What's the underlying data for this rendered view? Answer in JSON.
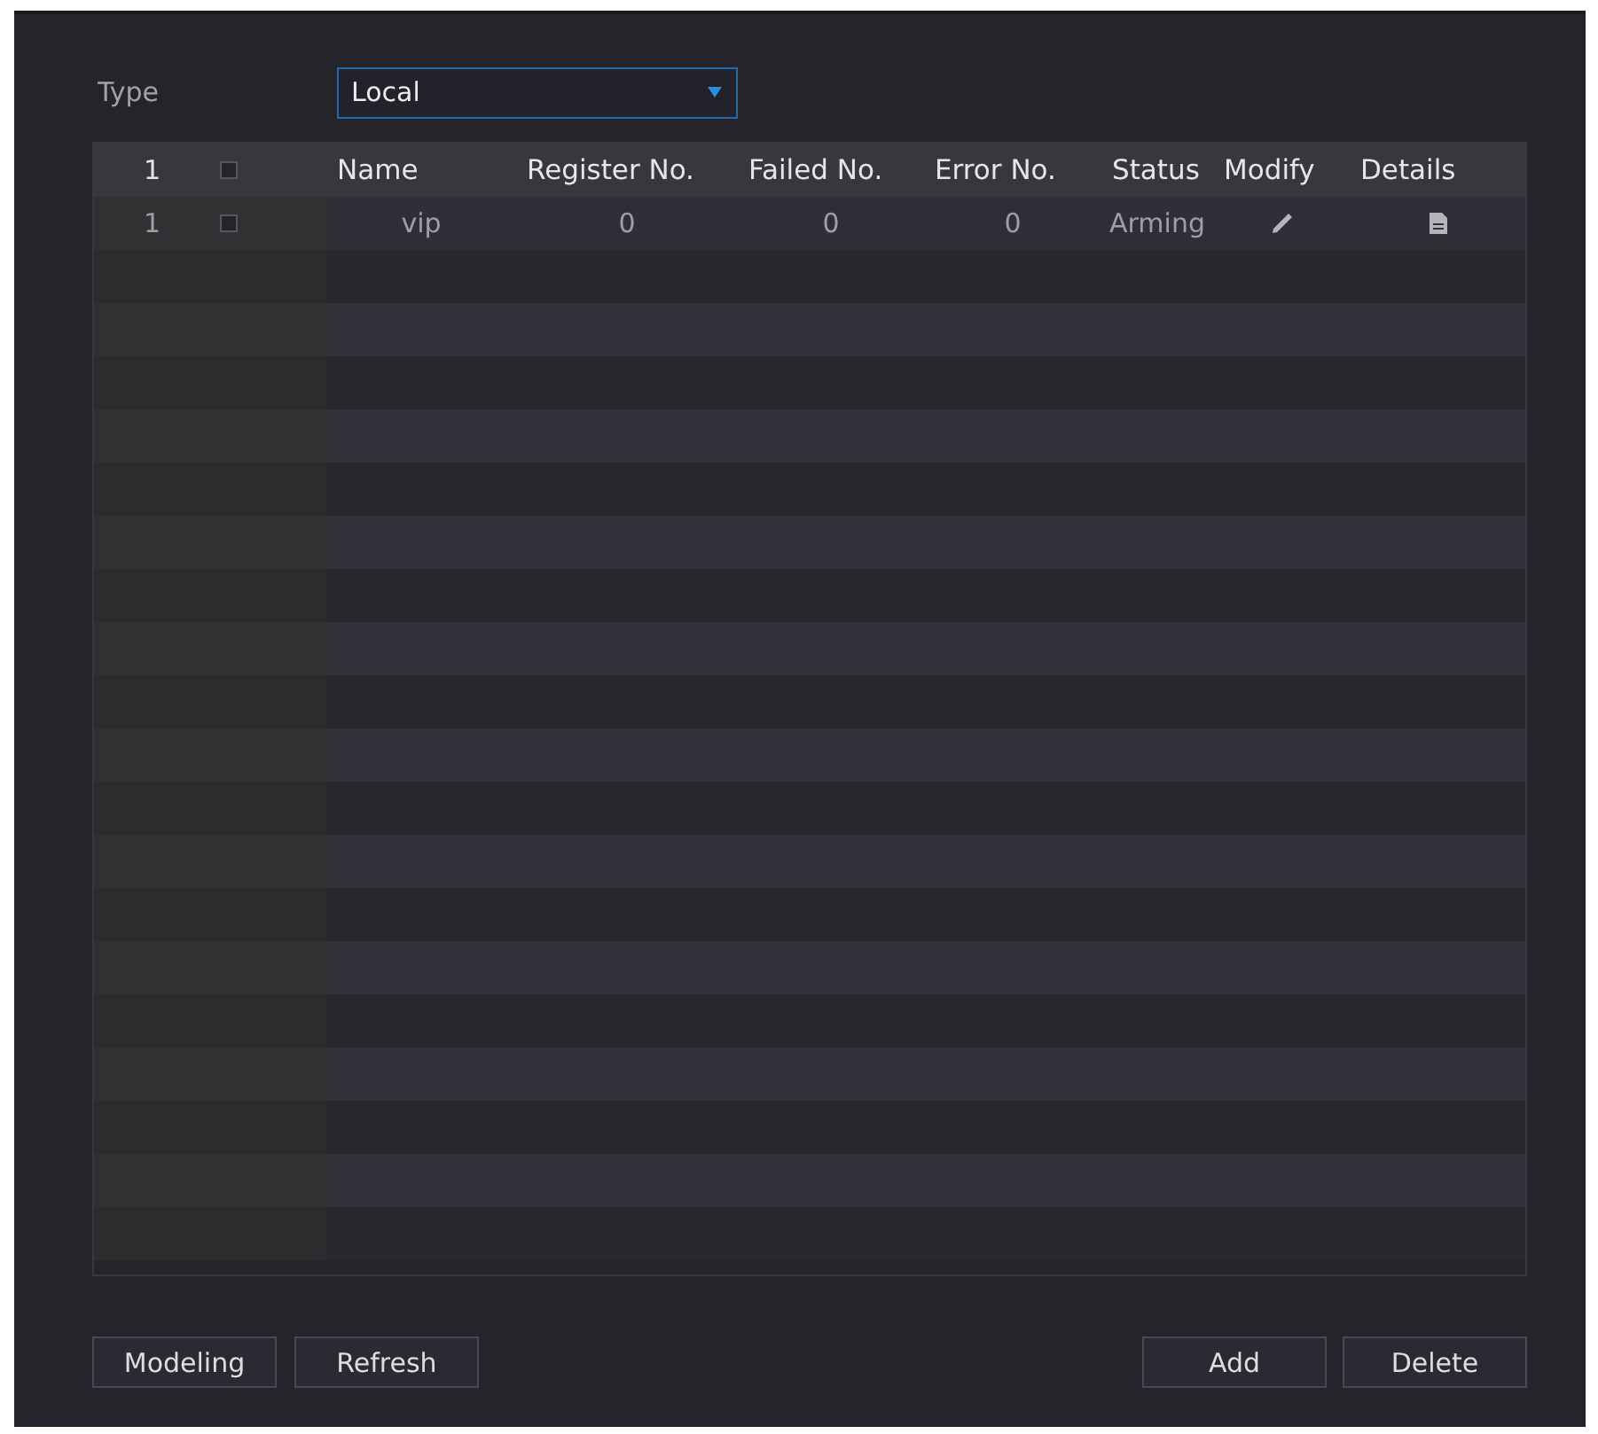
{
  "type_field": {
    "label": "Type",
    "value": "Local"
  },
  "table": {
    "index_header": "1",
    "select_all": {
      "checked": false
    },
    "columns": [
      "Name",
      "Register No.",
      "Failed No.",
      "Error No.",
      "Status",
      "Modify",
      "Details"
    ],
    "rows": [
      {
        "index": "1",
        "checked": false,
        "cells": [
          "vip",
          "0",
          "0",
          "0",
          "Arming"
        ]
      }
    ]
  },
  "buttons_left": [
    "Modeling",
    "Refresh"
  ],
  "buttons_right": [
    "Add",
    "Delete"
  ]
}
